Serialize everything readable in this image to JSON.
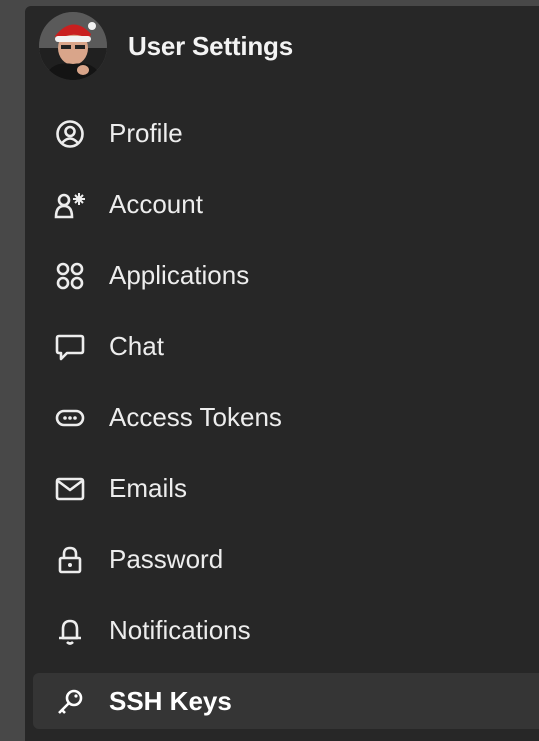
{
  "header": {
    "title": "User Settings"
  },
  "menu": {
    "items": [
      {
        "label": "Profile",
        "icon": "user-circle-icon"
      },
      {
        "label": "Account",
        "icon": "user-gear-icon"
      },
      {
        "label": "Applications",
        "icon": "grid-icon"
      },
      {
        "label": "Chat",
        "icon": "chat-bubble-icon"
      },
      {
        "label": "Access Tokens",
        "icon": "token-icon"
      },
      {
        "label": "Emails",
        "icon": "mail-icon"
      },
      {
        "label": "Password",
        "icon": "lock-icon"
      },
      {
        "label": "Notifications",
        "icon": "bell-icon"
      },
      {
        "label": "SSH Keys",
        "icon": "key-icon"
      }
    ],
    "active_item": "SSH Keys"
  },
  "colors": {
    "background": "#484848",
    "panel": "#272727",
    "active_item": "#353535",
    "text": "#ededed"
  }
}
